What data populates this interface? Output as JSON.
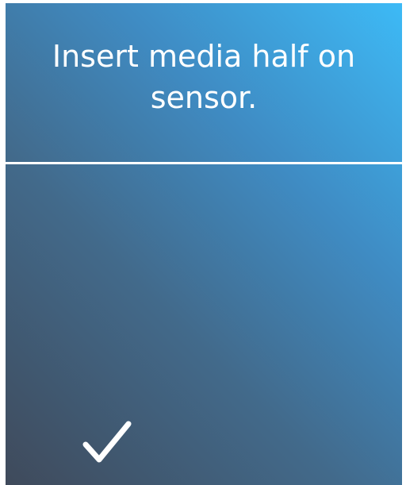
{
  "screen": {
    "instruction": "Insert media half on sensor."
  },
  "actions": {
    "confirm_icon": "checkmark-icon"
  },
  "colors": {
    "gradient_dark": "#3f4a5b",
    "gradient_light": "#3dbaf6",
    "text": "#ffffff",
    "divider": "#ffffff"
  }
}
